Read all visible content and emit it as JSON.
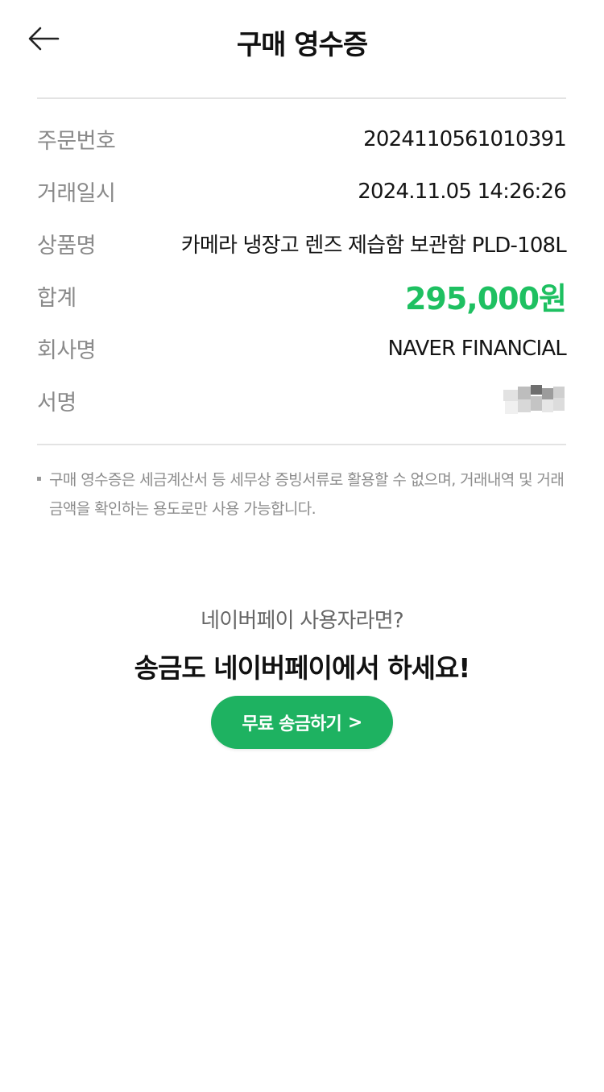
{
  "header": {
    "title": "구매 영수증"
  },
  "receipt": {
    "rows": [
      {
        "label": "주문번호",
        "value": "2024110561010391"
      },
      {
        "label": "거래일시",
        "value": "2024.11.05 14:26:26"
      },
      {
        "label": "상품명",
        "value": "카메라 냉장고 렌즈 제습함 보관함 PLD-108L"
      },
      {
        "label": "합계",
        "value": "295,000원"
      },
      {
        "label": "회사명",
        "value": "NAVER FINANCIAL"
      },
      {
        "label": "서명",
        "value": ""
      }
    ]
  },
  "notice": {
    "text": "구매 영수증은 세금계산서 등 세무상 증빙서류로 활용할 수 없으며, 거래내역 및 거래금액을 확인하는 용도로만 사용 가능합니다."
  },
  "promo": {
    "subtitle": "네이버페이 사용자라면?",
    "headline": "송금도 네이버페이에서 하세요!",
    "cta_label": "무료 송금하기",
    "cta_chevron": ">"
  },
  "colors": {
    "accent_green": "#1ec061",
    "button_green": "#1eb261"
  }
}
